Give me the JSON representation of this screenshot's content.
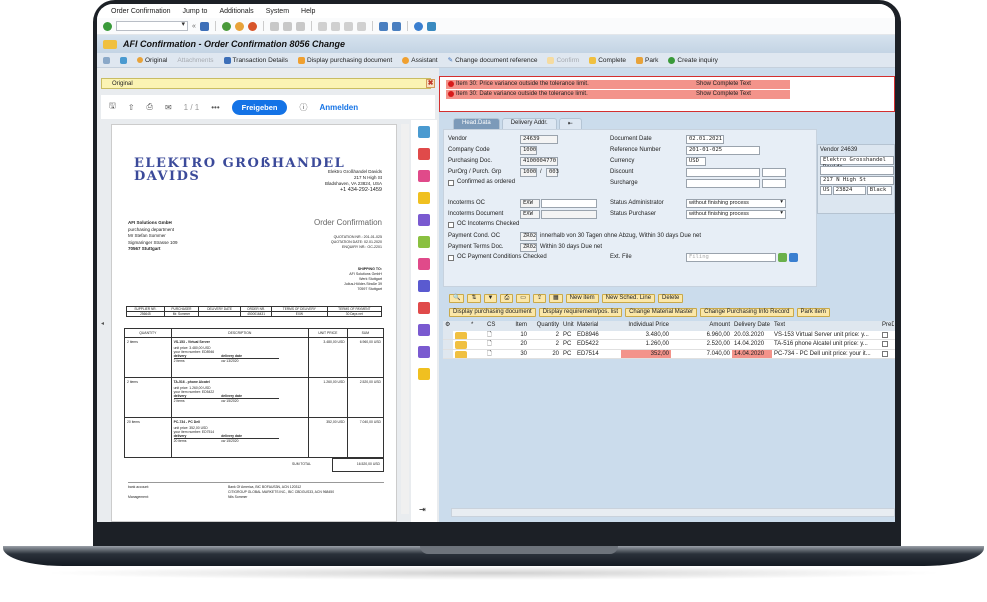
{
  "menu": [
    "Order Confirmation",
    "Jump to",
    "Additionals",
    "System",
    "Help"
  ],
  "title": "AFI Confirmation - Order Confirmation 8056 Change",
  "appbar": [
    {
      "label": "Original",
      "enabled": true
    },
    {
      "label": "Attachments",
      "enabled": false
    },
    {
      "label": "Transaction Details",
      "enabled": true
    },
    {
      "label": "Display purchasing document",
      "enabled": true
    },
    {
      "label": "Assistant",
      "enabled": true
    },
    {
      "label": "Change document reference",
      "enabled": true
    },
    {
      "label": "Confirm",
      "enabled": false
    },
    {
      "label": "Complete",
      "enabled": true
    },
    {
      "label": "Park",
      "enabled": true
    },
    {
      "label": "Create inquiry",
      "enabled": true
    }
  ],
  "left": {
    "original_label": "Original",
    "page_indicator": "1 / 1",
    "share_button": "Freigeben",
    "signin_link": "Anmelden",
    "doc": {
      "logo_line1": "ELEKTRO GROßHANDEL",
      "logo_line2": "DAVIDS",
      "sender": [
        "Elektro Großhandel Davids",
        "217 N High St",
        "Bladshaven, VA 23824, USA",
        "+1 434-292-1459"
      ],
      "recipient": [
        "AFI Solutions GmbH",
        "purchasing department",
        "Mr Stefan Sommer",
        "Sigmaringer Strasse 109",
        "70567 Stuttgart"
      ],
      "heading": "Order Confirmation",
      "quote_info": [
        "QUOTATION NR.: 201-01-025",
        "QUOTATION DATE: 02.01.2020",
        "ENQUIRY NR.: OC-2201"
      ],
      "shipping": [
        "SHIPPING TO:",
        "AFI Solutions GmbH",
        "Werk Stuttgart",
        "Julius-Hölder-Straße 39",
        "70597 Stuttgart"
      ],
      "header_table": {
        "cols": [
          "SUPPLIER NR.",
          "PURCHASER",
          "DELIVERY DATE",
          "ORDER NR.",
          "TERMS OF DELIVERY",
          "TERMS OF PAYMENT"
        ],
        "vals": [
          "256645",
          "Mr. Sommer",
          "",
          "4500016431",
          "EXW",
          "30 Days net"
        ]
      },
      "items_cols": [
        "QUANTITY",
        "DESCRIPTION",
        "UNIT PRICE",
        "SUM"
      ],
      "items": [
        {
          "qty": "2 items",
          "desc": "VS-153 - Virtual Server",
          "unit": "unit price: 3.480,00 USD",
          "ref": "your item number: ED8946",
          "del": "2 items",
          "date": "cw 13/2020",
          "price": "3.480,00 USD",
          "sum": "6.960,00 USD"
        },
        {
          "qty": "2 items",
          "desc": "TA-516 - phone Alcatel",
          "unit": "unit price: 1.260,00 USD",
          "ref": "your item number: ED5422",
          "del": "2 items",
          "date": "cw 15/2020",
          "price": "1.260,00 USD",
          "sum": "2.520,00 USD"
        },
        {
          "qty": "20 items",
          "desc": "PC-734 - PC Dell",
          "unit": "unit price: 352,00 USD",
          "ref": "your item number: ED7514",
          "del": "20 items",
          "date": "cw 15/2020",
          "price": "352,00 USD",
          "sum": "7.040,00 USD"
        }
      ],
      "delivery_label": "delivery",
      "delivery_date_label": "delivery date",
      "sum_total_label": "SUM TOTAL",
      "sum_total": "16.520,00 USD",
      "bank_label": "bank account:",
      "bank": [
        "Bank Of America, BIC BOFAUS3N, ACN 120312",
        "CITIGROUP GLOBAL MARKETS INC., BIC CBDGUS33, ACN 968450"
      ],
      "mgmt_label": "Management:",
      "mgmt": "Nils Sommer"
    }
  },
  "messages": [
    {
      "text": "Item 30: Price variance outside the tolerance limit.",
      "link": "Show Complete Text"
    },
    {
      "text": "Item 30: Date variance outside the tolerance limit.",
      "link": "Show Complete Text"
    }
  ],
  "tabs": [
    "Head.Data",
    "Delivery Addr.",
    ""
  ],
  "head": {
    "vendor_label": "Vendor",
    "vendor": "24639",
    "company_label": "Company Code",
    "company": "1000",
    "pdoc_label": "Purchasing Doc.",
    "pdoc": "4100004770",
    "purorg_label": "PurOrg   / Purch. Grp",
    "purorg": "1000",
    "purgrp": "003",
    "confirmed_label": "Confirmed as ordered",
    "docdate_label": "Document Date",
    "docdate": "02.01.2021",
    "ref_label": "Reference Number",
    "ref": "201-01-025",
    "cur_label": "Currency",
    "cur": "USD",
    "disc_label": "Discount",
    "surch_label": "Surcharge",
    "inco_oc_label": "Incoterms OC",
    "inco_oc": "EXW",
    "inco_doc_label": "Incoterms Document",
    "inco_doc": "EXW",
    "inco_chk_label": "OC Incoterms Checked",
    "pay_oc_label": "Payment Cond. OC",
    "pay_oc": "ZR02",
    "pay_oc_text": "innerhalb von 30 Tagen ohne Abzug, Within 30 days Due net",
    "pay_doc_label": "Payment Terms Doc.",
    "pay_doc": "ZR02",
    "pay_doc_text": "Within 30 days Due net",
    "pay_chk_label": "OC Payment Conditions Checked",
    "stat_admin_label": "Status Administrator",
    "stat_admin": "without finishing process",
    "stat_purch_label": "Status Purchaser",
    "stat_purch": "without finishing process",
    "extfile_label": "Ext. File",
    "extfile_placeholder": "Filing"
  },
  "vendor_box": {
    "title": "Vendor 24639",
    "name": "Elektro Grosshandel Davids",
    "street": "217 N High St",
    "country": "US",
    "zip": "23824",
    "city": "Black"
  },
  "grid_toolbar": [
    "New item",
    "New Sched. Line",
    "Delete"
  ],
  "grid_actions": [
    "Display purchasing document",
    "Display requirement/pos. list",
    "Change Material Master",
    "Change Purchasing Info Record",
    "Park item"
  ],
  "grid": {
    "cols": [
      "*",
      "CS",
      "Item",
      "Quantity",
      "Unit",
      "Material",
      "Individual Price",
      "Amount",
      "Delivery Date",
      "Text",
      "PreDel"
    ],
    "rows": [
      {
        "item": "10",
        "qty": "2",
        "unit": "PC",
        "mat": "ED8946",
        "price": "3.480,00",
        "amount": "6.960,00",
        "date": "20.03.2020",
        "text": "VS-153 Virtual Server  unit price:  y...",
        "price_flag": false,
        "date_flag": false
      },
      {
        "item": "20",
        "qty": "2",
        "unit": "PC",
        "mat": "ED5422",
        "price": "1.260,00",
        "amount": "2.520,00",
        "date": "14.04.2020",
        "text": "TA-516 phone Alcatel  unit price:  y...",
        "price_flag": false,
        "date_flag": false
      },
      {
        "item": "30",
        "qty": "20",
        "unit": "PC",
        "mat": "ED7514",
        "price": "352,00",
        "amount": "7.040,00",
        "date": "14.04.2020",
        "text": "PC-734 - PC Dell  unit price:  your it...",
        "price_flag": true,
        "date_flag": true
      }
    ]
  },
  "colors": {
    "error_bg": "#f3938a",
    "error_border": "#d32f2f",
    "accent": "#1473e6",
    "sap_bg": "#cbdcec"
  }
}
